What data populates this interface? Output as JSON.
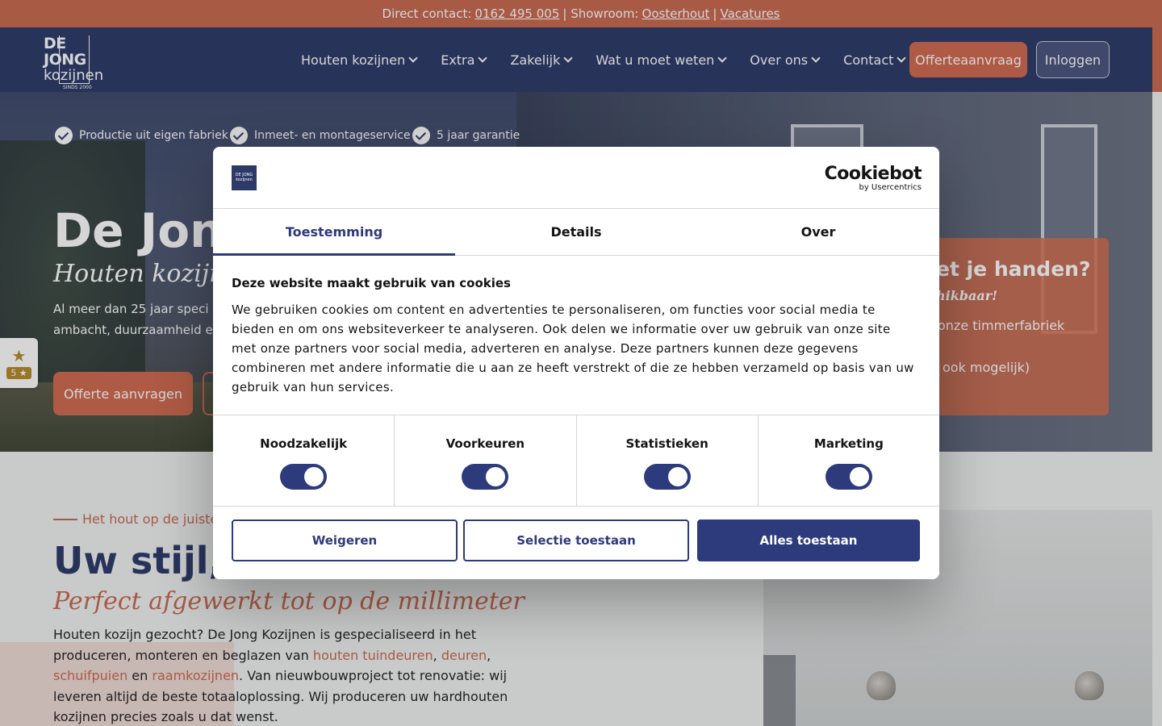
{
  "topbar": {
    "prefix": "Direct contact:",
    "phone": "0162 495 005",
    "sep1": "| Showroom:",
    "showroom": "Oosterhout",
    "sep2": "|",
    "jobs": "Vacatures"
  },
  "logo": {
    "line1": "DE JONG",
    "line2": "kozijnen",
    "line3": "SINDS 2000"
  },
  "nav": {
    "items": [
      {
        "label": "Houten kozijnen"
      },
      {
        "label": "Extra"
      },
      {
        "label": "Zakelijk"
      },
      {
        "label": "Wat u moet weten"
      },
      {
        "label": "Over ons"
      },
      {
        "label": "Contact"
      }
    ],
    "quote_button": "Offerteaanvraag",
    "login_button": "Inloggen"
  },
  "hero": {
    "usps": [
      "Productie uit eigen fabriek",
      "Inmeet- en montageservice",
      "5 jaar garantie"
    ],
    "title": "De Jon",
    "subtitle": "Houten kozijnen",
    "text_line1": "Al meer dan 25 jaar speci",
    "text_line2": "ambacht, duurzaamheid en",
    "cta": "Offerte aanvragen"
  },
  "promo": {
    "title": "et je handen?",
    "subtitle": "hikbaar!",
    "line1": "onze timmerfabriek",
    "line2": "ook mogelijk)"
  },
  "review_widget": {
    "rating": "5 ★",
    "icon": "star-icon"
  },
  "content": {
    "kicker": "Het hout op de juiste",
    "heading": "Uw stijl,",
    "subheading": "Perfect afgewerkt tot op de millimeter",
    "p_part1": "Houten kozijn gezocht? De Jong Kozijnen is gespecialiseerd in het produceren, monteren en beglazen van ",
    "link1": "houten tuindeuren",
    "comma1": ", ",
    "link2": "deuren",
    "comma2": ", ",
    "link3": "schuifpuien",
    "p_part2": " en ",
    "link4": "raamkozijnen",
    "p_part3": ". Van nieuwbouwproject tot renovatie: wij leveren altijd de beste totaaloplossing. Wij produceren uw hardhouten kozijnen precies zoals u dat wenst."
  },
  "cookie_dialog": {
    "logo_text": "DE JONG kozijnen",
    "brand": "Cookiebot",
    "brand_sub": "by Usercentrics",
    "tabs": [
      {
        "label": "Toestemming",
        "active": true
      },
      {
        "label": "Details",
        "active": false
      },
      {
        "label": "Over",
        "active": false
      }
    ],
    "heading": "Deze website maakt gebruik van cookies",
    "body": "We gebruiken cookies om content en advertenties te personaliseren, om functies voor social media te bieden en om ons websiteverkeer te analyseren. Ook delen we informatie over uw gebruik van onze site met onze partners voor social media, adverteren en analyse. Deze partners kunnen deze gegevens combineren met andere informatie die u aan ze heeft verstrekt of die ze hebben verzameld op basis van uw gebruik van hun services.",
    "consents": [
      {
        "label": "Noodzakelijk",
        "checked": true
      },
      {
        "label": "Voorkeuren",
        "checked": true
      },
      {
        "label": "Statistieken",
        "checked": true
      },
      {
        "label": "Marketing",
        "checked": true
      }
    ],
    "buttons": {
      "deny": "Weigeren",
      "selection": "Selectie toestaan",
      "allow_all": "Alles toestaan"
    }
  },
  "colors": {
    "brand_navy": "#2d3a68",
    "brand_orange": "#c96a4f",
    "cookie_accent": "#2d3a7b"
  }
}
